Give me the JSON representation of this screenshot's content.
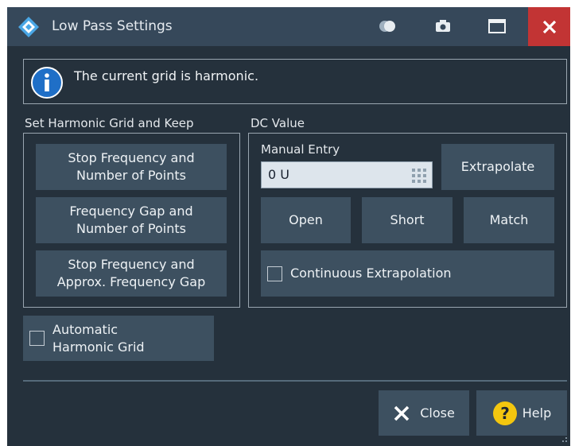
{
  "window": {
    "title": "Low Pass Settings"
  },
  "info": {
    "message": "The current grid is harmonic."
  },
  "harmonic_grid": {
    "group_label": "Set Harmonic Grid and Keep",
    "buttons": [
      {
        "line1": "Stop Frequency and",
        "line2": "Number of Points"
      },
      {
        "line1": "Frequency Gap and",
        "line2": "Number of Points"
      },
      {
        "line1": "Stop Frequency and",
        "line2": "Approx. Frequency Gap"
      }
    ]
  },
  "dc_value": {
    "group_label": "DC Value",
    "manual_entry_label": "Manual Entry",
    "manual_entry_value": "0 U",
    "extrapolate_label": "Extrapolate",
    "open_label": "Open",
    "short_label": "Short",
    "match_label": "Match",
    "continuous_label": "Continuous Extrapolation"
  },
  "auto_grid": {
    "line1": "Automatic",
    "line2": "Harmonic Grid"
  },
  "footer": {
    "close_label": "Close",
    "help_label": "Help"
  },
  "colors": {
    "background": "#25313c",
    "titlebar": "#36485a",
    "button": "#3d5060",
    "close_red": "#c23434",
    "info_blue": "#1f6fc7",
    "help_yellow": "#f3c60f"
  }
}
